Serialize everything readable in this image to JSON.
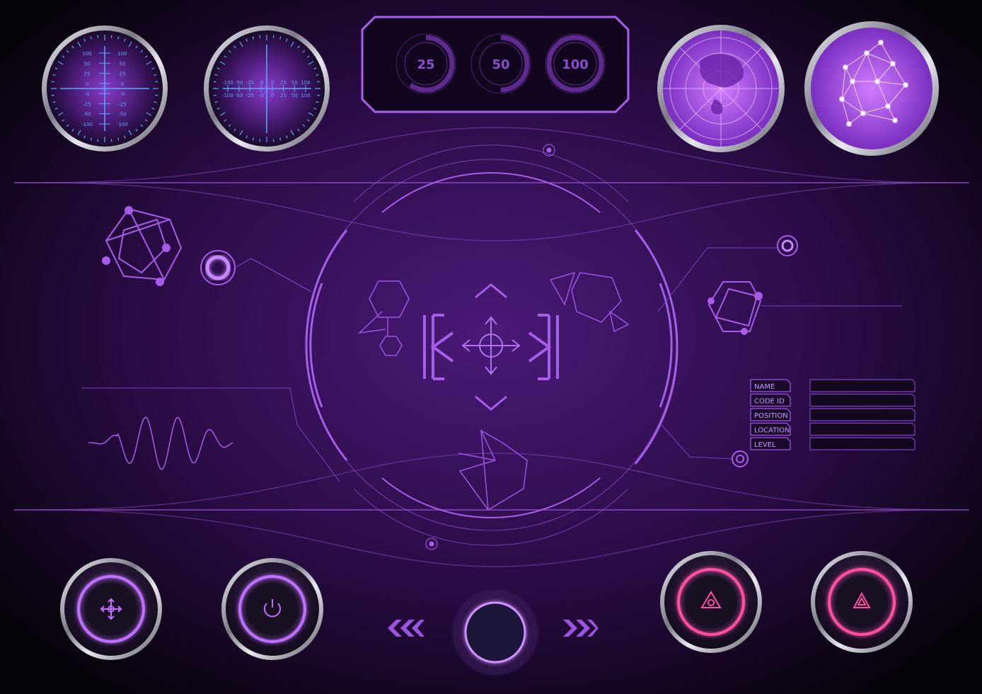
{
  "colors": {
    "accent": "#b066ff",
    "background": "#2a0c45",
    "scale_blue": "#5aa8ff",
    "alert_red": "#ff3a6a"
  },
  "top_gauges": [
    {
      "name": "vertical-scale-gauge",
      "labels": [
        "100",
        "50",
        "25",
        "0",
        "-0",
        "-25",
        "-50",
        "-100"
      ]
    },
    {
      "name": "horizontal-scale-gauge",
      "labels": [
        "-100",
        "-50",
        "-25",
        "-0",
        "0",
        "25",
        "50",
        "100"
      ]
    }
  ],
  "level_panel": {
    "rings": [
      {
        "label": "25",
        "fill_percent": 60
      },
      {
        "label": "50",
        "fill_percent": 50
      },
      {
        "label": "100",
        "fill_percent": 100
      }
    ]
  },
  "info_form": {
    "fields": [
      {
        "label": "NAME",
        "value": ""
      },
      {
        "label": "CODE  ID",
        "value": ""
      },
      {
        "label": "POSITION",
        "value": ""
      },
      {
        "label": "LOCATION",
        "value": ""
      },
      {
        "label": "LEVEL",
        "value": ""
      }
    ]
  },
  "bottom_buttons": [
    {
      "icon": "move-arrows-icon"
    },
    {
      "icon": "power-icon"
    },
    {
      "icon": "center-circle-icon"
    },
    {
      "icon": "biohazard-icon"
    },
    {
      "icon": "warning-triangle-icon"
    }
  ],
  "nav": {
    "prev_icon": "chevrons-left-icon",
    "next_icon": "chevrons-right-icon"
  }
}
